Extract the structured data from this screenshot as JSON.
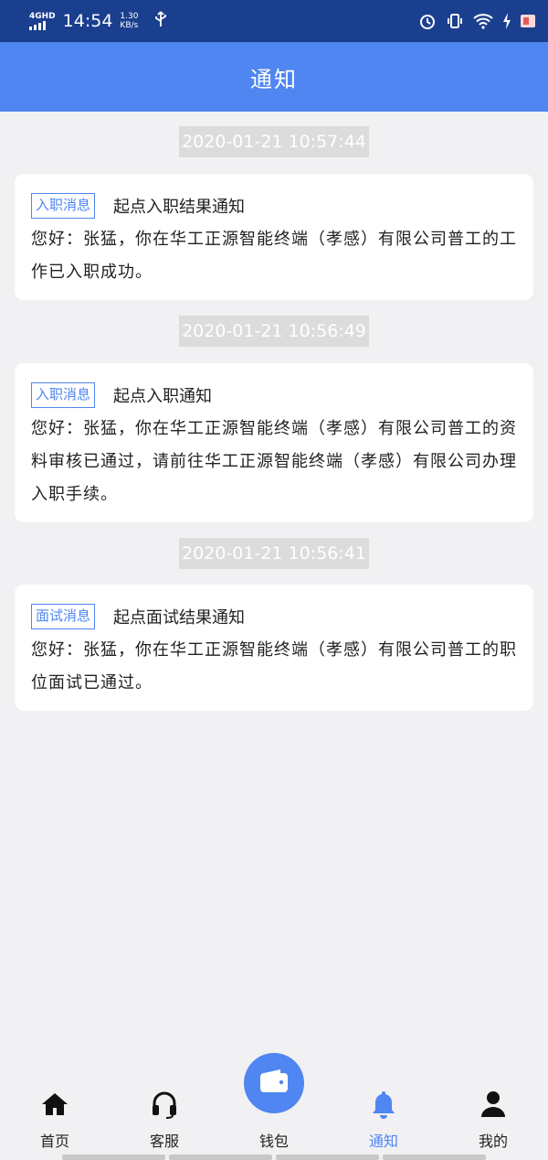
{
  "status_bar": {
    "network": "4GHD",
    "time": "14:54",
    "speed_value": "1.30",
    "speed_unit": "KB/s"
  },
  "header": {
    "title": "通知"
  },
  "notifications": [
    {
      "timestamp": "2020-01-21  10:57:44",
      "tag": "入职消息",
      "title": "起点入职结果通知",
      "body": "您好：张猛，你在华工正源智能终端（孝感）有限公司普工的工作已入职成功。"
    },
    {
      "timestamp": "2020-01-21  10:56:49",
      "tag": "入职消息",
      "title": "起点入职通知",
      "body": "您好：张猛，你在华工正源智能终端（孝感）有限公司普工的资料审核已通过，请前往华工正源智能终端（孝感）有限公司办理入职手续。"
    },
    {
      "timestamp": "2020-01-21  10:56:41",
      "tag": "面试消息",
      "title": "起点面试结果通知",
      "body": "您好：张猛，你在华工正源智能终端（孝感）有限公司普工的职位面试已通过。"
    }
  ],
  "bottom_nav": {
    "home": "首页",
    "service": "客服",
    "wallet": "钱包",
    "notify": "通知",
    "mine": "我的"
  },
  "colors": {
    "accent": "#4f86f1",
    "status_bar": "#1b3f8f",
    "background": "#f1f1f3"
  }
}
